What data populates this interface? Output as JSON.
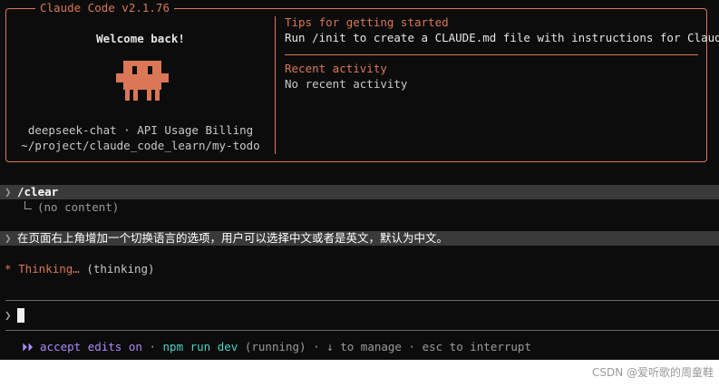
{
  "app": {
    "title": "Claude Code v2.1.76",
    "accent_color": "#d97757"
  },
  "welcome": {
    "greeting": "Welcome back!",
    "mascot_icon": "claude-mascot-icon",
    "model_line": "deepseek-chat · API Usage Billing",
    "cwd": "~/project/claude_code_learn/my-todo"
  },
  "tips": {
    "heading": "Tips for getting started",
    "text": "Run /init to create a CLAUDE.md file with instructions for Claude"
  },
  "recent": {
    "heading": "Recent activity",
    "text": "No recent activity"
  },
  "conversation": {
    "prompt_glyph": "❯",
    "clear_command": "/clear",
    "clear_result": "(no content)",
    "user_message": "在页面右上角增加一个切换语言的选项，用户可以选择中文或者是英文，默认为中文。",
    "thinking_star": "*",
    "thinking_word": "Thinking…",
    "thinking_detail": "(thinking)"
  },
  "input": {
    "prompt_glyph": "❯",
    "value": ""
  },
  "status": {
    "accept_edits": "⏵⏵ accept edits on",
    "separator": "·",
    "npm_task": "npm run dev",
    "npm_state": "(running)",
    "manage_hint": "↓ to manage",
    "interrupt_hint": "esc to interrupt"
  },
  "watermark": "CSDN @爱听歌的周童鞋"
}
